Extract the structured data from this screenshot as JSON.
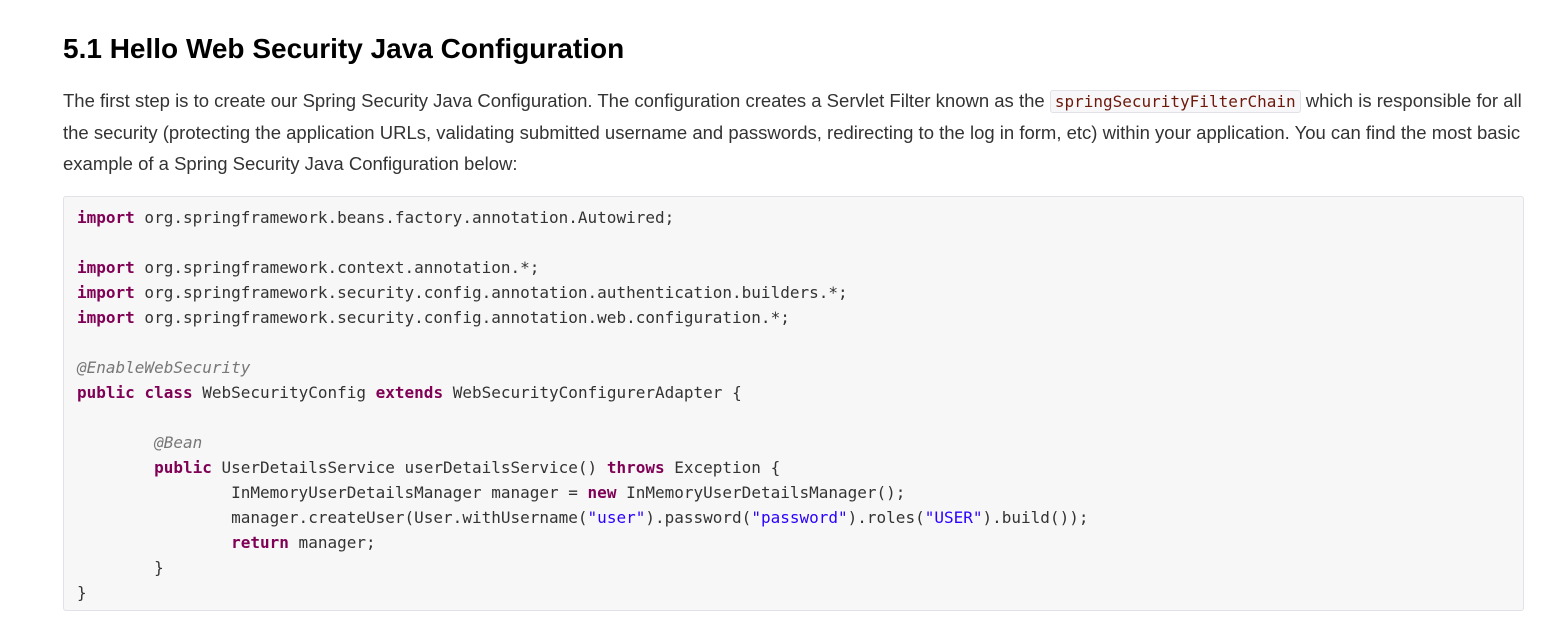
{
  "section": {
    "title": "5.1 Hello Web Security Java Configuration"
  },
  "intro": {
    "part1": "The first step is to create our Spring Security Java Configuration. The configuration creates a Servlet Filter known as the ",
    "inline_code": "springSecurityFilterChain",
    "part2": " which is responsible for all the security (protecting the application URLs, validating submitted username and passwords, redirecting to the log in form, etc) within your application. You can find the most basic example of a Spring Security Java Configuration below:"
  },
  "code": {
    "lines": [
      {
        "tokens": [
          {
            "t": "kw",
            "v": "import"
          },
          {
            "t": "plain",
            "v": " org.springframework.beans.factory.annotation.Autowired;"
          }
        ]
      },
      {
        "tokens": []
      },
      {
        "tokens": [
          {
            "t": "kw",
            "v": "import"
          },
          {
            "t": "plain",
            "v": " org.springframework.context.annotation.*;"
          }
        ]
      },
      {
        "tokens": [
          {
            "t": "kw",
            "v": "import"
          },
          {
            "t": "plain",
            "v": " org.springframework.security.config.annotation.authentication.builders.*;"
          }
        ]
      },
      {
        "tokens": [
          {
            "t": "kw",
            "v": "import"
          },
          {
            "t": "plain",
            "v": " org.springframework.security.config.annotation.web.configuration.*;"
          }
        ]
      },
      {
        "tokens": []
      },
      {
        "tokens": [
          {
            "t": "ann",
            "v": "@EnableWebSecurity"
          }
        ]
      },
      {
        "tokens": [
          {
            "t": "kw",
            "v": "public"
          },
          {
            "t": "plain",
            "v": " "
          },
          {
            "t": "kw",
            "v": "class"
          },
          {
            "t": "plain",
            "v": " WebSecurityConfig "
          },
          {
            "t": "kw",
            "v": "extends"
          },
          {
            "t": "plain",
            "v": " WebSecurityConfigurerAdapter {"
          }
        ]
      },
      {
        "tokens": []
      },
      {
        "tokens": [
          {
            "t": "plain",
            "v": "\t"
          },
          {
            "t": "ann",
            "v": "@Bean"
          }
        ]
      },
      {
        "tokens": [
          {
            "t": "plain",
            "v": "\t"
          },
          {
            "t": "kw",
            "v": "public"
          },
          {
            "t": "plain",
            "v": " UserDetailsService userDetailsService() "
          },
          {
            "t": "kw",
            "v": "throws"
          },
          {
            "t": "plain",
            "v": " Exception {"
          }
        ]
      },
      {
        "tokens": [
          {
            "t": "plain",
            "v": "\t\tInMemoryUserDetailsManager manager = "
          },
          {
            "t": "kw",
            "v": "new"
          },
          {
            "t": "plain",
            "v": " InMemoryUserDetailsManager();"
          }
        ]
      },
      {
        "tokens": [
          {
            "t": "plain",
            "v": "\t\tmanager.createUser(User.withUsername("
          },
          {
            "t": "str",
            "v": "\"user\""
          },
          {
            "t": "plain",
            "v": ").password("
          },
          {
            "t": "str",
            "v": "\"password\""
          },
          {
            "t": "plain",
            "v": ").roles("
          },
          {
            "t": "str",
            "v": "\"USER\""
          },
          {
            "t": "plain",
            "v": ").build());"
          }
        ]
      },
      {
        "tokens": [
          {
            "t": "plain",
            "v": "\t\t"
          },
          {
            "t": "kw",
            "v": "return"
          },
          {
            "t": "plain",
            "v": " manager;"
          }
        ]
      },
      {
        "tokens": [
          {
            "t": "plain",
            "v": "\t}"
          }
        ]
      },
      {
        "tokens": [
          {
            "t": "plain",
            "v": "}"
          }
        ]
      }
    ],
    "colors": {
      "keyword": "#7f0055",
      "annotation": "#777777",
      "string": "#2a00ff",
      "inline_code": "#6d180b"
    }
  }
}
